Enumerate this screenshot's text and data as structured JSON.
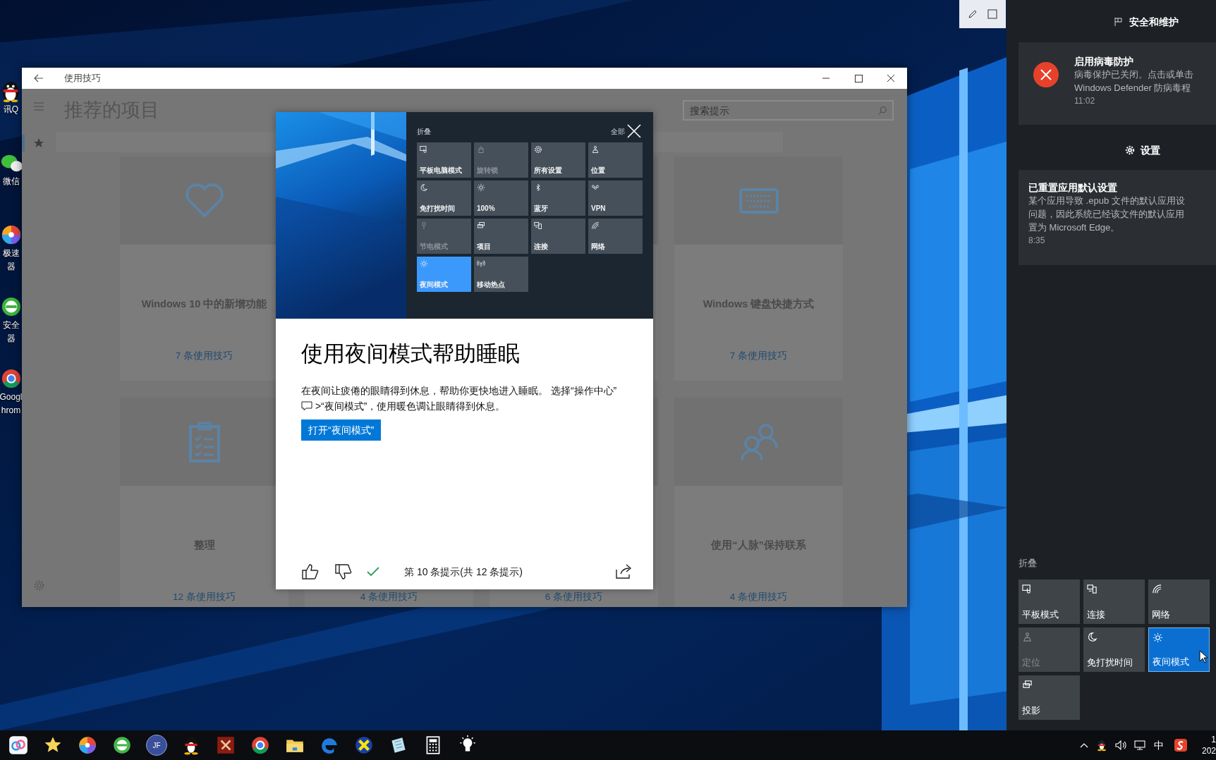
{
  "desktop_icons": [
    {
      "lines": [
        "讯Q"
      ]
    },
    {
      "lines": [
        "微信"
      ]
    },
    {
      "lines": [
        "极速",
        "器"
      ]
    },
    {
      "lines": [
        "安全",
        "器"
      ]
    },
    {
      "lines": [
        "Googl",
        "hrom"
      ]
    }
  ],
  "app": {
    "title": "使用技巧",
    "heading": "推荐的项目",
    "search": {
      "placeholder": "搜索提示"
    },
    "cards": [
      {
        "title": "Windows 10 中的新增功能",
        "count": "7 条使用技巧"
      },
      {
        "title": "Windows 键盘快捷方式",
        "count": "7 条使用技巧"
      },
      {
        "title": "整理",
        "count": "12 条使用技巧"
      },
      {
        "count": "4 条使用技巧"
      },
      {
        "count": "6 条使用技巧"
      },
      {
        "title": "使用“人脉”保持联系",
        "count": "4 条使用技巧"
      }
    ]
  },
  "tip_dialog": {
    "image": {
      "header": "折叠",
      "clear_label": "全部",
      "tiles": [
        {
          "label": "平板电脑模式",
          "on": false,
          "disabled": false
        },
        {
          "label": "旋转锁",
          "on": false,
          "disabled": true
        },
        {
          "label": "所有设置",
          "on": false,
          "disabled": false
        },
        {
          "label": "位置",
          "on": false,
          "disabled": false
        },
        {
          "label": "免打扰时间",
          "on": false,
          "disabled": false
        },
        {
          "label": "100%",
          "on": false,
          "disabled": false
        },
        {
          "label": "蓝牙",
          "on": false,
          "disabled": false
        },
        {
          "label": "VPN",
          "on": false,
          "disabled": false
        },
        {
          "label": "节电模式",
          "on": false,
          "disabled": true
        },
        {
          "label": "项目",
          "on": false,
          "disabled": false
        },
        {
          "label": "连接",
          "on": false,
          "disabled": false
        },
        {
          "label": "网络",
          "on": false,
          "disabled": false
        },
        {
          "label": "夜间模式",
          "on": true,
          "disabled": false
        },
        {
          "label": "移动热点",
          "on": false,
          "disabled": false
        }
      ]
    },
    "title": "使用夜间模式帮助睡眠",
    "text_before": "在夜间让疲倦的眼睛得到休息，帮助你更快地进入睡眠。 选择“操作中心”",
    "text_after": " >“夜间模式”，使用暖色调让眼睛得到休息。",
    "button": "打开“夜间模式”",
    "position": "第 10 条提示(共 12 条提示)"
  },
  "action_center": {
    "groups": [
      {
        "header": "安全和维护",
        "notifications": [
          {
            "kind": "error",
            "title": "启用病毒防护",
            "lines": [
              "病毒保护已关闭。点击或单击",
              "Windows Defender 防病毒程"
            ],
            "time": "11:02"
          }
        ]
      },
      {
        "header": "设置",
        "notifications": [
          {
            "kind": "plain",
            "title": "已重置应用默认设置",
            "lines": [
              "某个应用导致 .epub 文件的默认应用设",
              "问题，因此系统已经该文件的默认应用",
              "置为 Microsoft Edge。"
            ],
            "time": "8:35"
          }
        ]
      }
    ],
    "collapse": "折叠",
    "tiles": [
      {
        "label": "平板模式",
        "on": false,
        "disabled": false
      },
      {
        "label": "连接",
        "on": false,
        "disabled": false
      },
      {
        "label": "网络",
        "on": false,
        "disabled": false
      },
      {
        "label": "定位",
        "on": false,
        "disabled": true
      },
      {
        "label": "免打扰时间",
        "on": false,
        "disabled": false
      },
      {
        "label": "夜间模式",
        "on": true,
        "disabled": false
      },
      {
        "label": "投影",
        "on": false,
        "disabled": false
      }
    ]
  },
  "taskbar": {
    "jf_icon_text": "JF",
    "input_method": "中",
    "clock": [
      "1",
      "202"
    ]
  }
}
